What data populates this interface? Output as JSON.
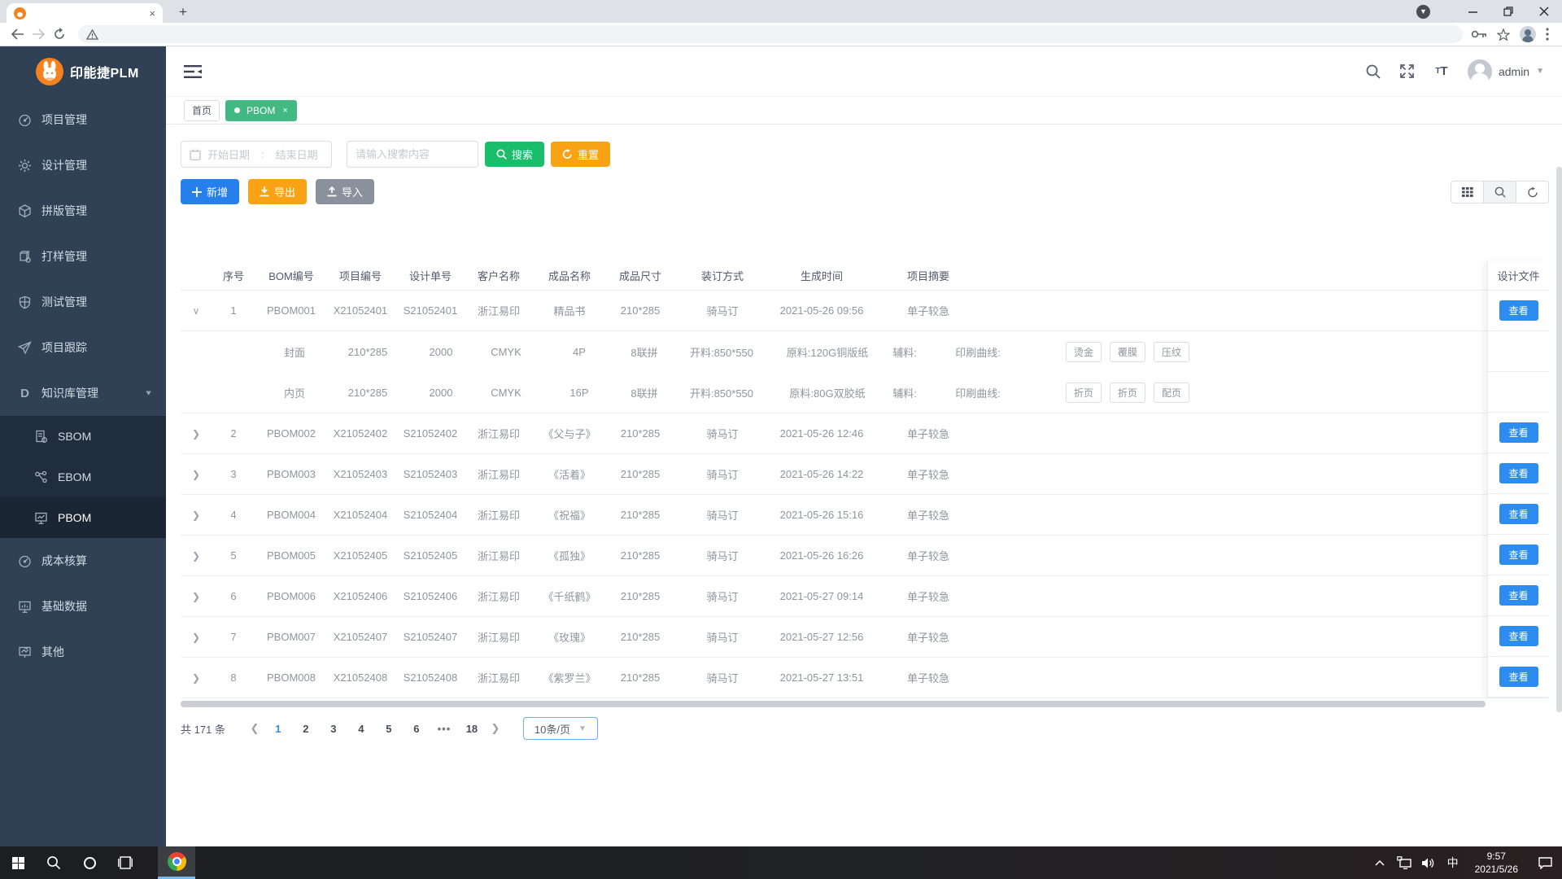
{
  "colors": {
    "primary": "#2d8cf0",
    "success": "#19be6b",
    "warning": "#f9a314",
    "tab_green": "#42b983",
    "sidebar_bg": "#304156",
    "submenu_bg": "#1f2d3d",
    "add_blue": "#2680eb",
    "import_gray": "#8a919c"
  },
  "browser": {
    "new_tab_label": "+",
    "tab_close": "×"
  },
  "header": {
    "logo_text": "印能捷PLM",
    "user_name": "admin"
  },
  "sidebar": {
    "items": [
      {
        "label": "项目管理",
        "icon": "dashboard-icon"
      },
      {
        "label": "设计管理",
        "icon": "gear-icon"
      },
      {
        "label": "拼版管理",
        "icon": "cube-icon"
      },
      {
        "label": "打样管理",
        "icon": "proof-icon"
      },
      {
        "label": "测试管理",
        "icon": "shield-icon"
      },
      {
        "label": "项目跟踪",
        "icon": "send-icon"
      },
      {
        "label": "知识库管理",
        "icon": "letter-d-icon",
        "expanded": true,
        "children": [
          {
            "label": "SBOM",
            "icon": "doc-icon"
          },
          {
            "label": "EBOM",
            "icon": "share-icon"
          },
          {
            "label": "PBOM",
            "icon": "monitor-icon",
            "active": true
          }
        ]
      },
      {
        "label": "成本核算",
        "icon": "dashboard-icon"
      },
      {
        "label": "基础数据",
        "icon": "data-icon"
      },
      {
        "label": "其他",
        "icon": "chart-icon"
      }
    ]
  },
  "page_tags": [
    {
      "label": "首页",
      "active": false,
      "closable": false
    },
    {
      "label": "PBOM",
      "active": true,
      "closable": true
    }
  ],
  "filters": {
    "date_start_placeholder": "开始日期",
    "date_separator": ":",
    "date_end_placeholder": "结束日期",
    "search_placeholder": "请输入搜索内容",
    "search_label": "搜索",
    "reset_label": "重置"
  },
  "actions": {
    "add_label": "新增",
    "export_label": "导出",
    "import_label": "导入"
  },
  "table": {
    "headers": [
      "序号",
      "BOM编号",
      "项目编号",
      "设计单号",
      "客户名称",
      "成品名称",
      "成品尺寸",
      "装订方式",
      "生成时间",
      "项目摘要"
    ],
    "fixed_header": "设计文件",
    "view_label": "查看",
    "rows": [
      {
        "no": "1",
        "bom": "PBOM001",
        "project": "X21052401",
        "design": "S21052401",
        "customer": "浙江易印",
        "product": "精品书",
        "size": "210*285",
        "binding": "骑马订",
        "time": "2021-05-26 09:56",
        "summary": "单子较急",
        "expanded": true
      },
      {
        "no": "2",
        "bom": "PBOM002",
        "project": "X21052402",
        "design": "S21052402",
        "customer": "浙江易印",
        "product": "《父与子》",
        "size": "210*285",
        "binding": "骑马订",
        "time": "2021-05-26 12:46",
        "summary": "单子较急",
        "expanded": false
      },
      {
        "no": "3",
        "bom": "PBOM003",
        "project": "X21052403",
        "design": "S21052403",
        "customer": "浙江易印",
        "product": "《活着》",
        "size": "210*285",
        "binding": "骑马订",
        "time": "2021-05-26 14:22",
        "summary": "单子较急",
        "expanded": false
      },
      {
        "no": "4",
        "bom": "PBOM004",
        "project": "X21052404",
        "design": "S21052404",
        "customer": "浙江易印",
        "product": "《祝福》",
        "size": "210*285",
        "binding": "骑马订",
        "time": "2021-05-26 15:16",
        "summary": "单子较急",
        "expanded": false
      },
      {
        "no": "5",
        "bom": "PBOM005",
        "project": "X21052405",
        "design": "S21052405",
        "customer": "浙江易印",
        "product": "《孤独》",
        "size": "210*285",
        "binding": "骑马订",
        "time": "2021-05-26 16:26",
        "summary": "单子较急",
        "expanded": false
      },
      {
        "no": "6",
        "bom": "PBOM006",
        "project": "X21052406",
        "design": "S21052406",
        "customer": "浙江易印",
        "product": "《千纸鹤》",
        "size": "210*285",
        "binding": "骑马订",
        "time": "2021-05-27 09:14",
        "summary": "单子较急",
        "expanded": false
      },
      {
        "no": "7",
        "bom": "PBOM007",
        "project": "X21052407",
        "design": "S21052407",
        "customer": "浙江易印",
        "product": "《玫瑰》",
        "size": "210*285",
        "binding": "骑马订",
        "time": "2021-05-27 12:56",
        "summary": "单子较急",
        "expanded": false
      },
      {
        "no": "8",
        "bom": "PBOM008",
        "project": "X21052408",
        "design": "S21052408",
        "customer": "浙江易印",
        "product": "《紫罗兰》",
        "size": "210*285",
        "binding": "骑马订",
        "time": "2021-05-27 13:51",
        "summary": "单子较急",
        "expanded": false
      }
    ],
    "subrows": [
      {
        "part": "封面",
        "size": "210*285",
        "qty": "2000",
        "color": "CMYK",
        "pages": "4P",
        "imposition": "8联拼",
        "cut": "开料:850*550",
        "material": "原料:120G铜版纸",
        "aux_label": "辅料:",
        "curve_label": "印刷曲线:",
        "tags": [
          "烫金",
          "覆膜",
          "压纹"
        ]
      },
      {
        "part": "内页",
        "size": "210*285",
        "qty": "2000",
        "color": "CMYK",
        "pages": "16P",
        "imposition": "8联拼",
        "cut": "开料:850*550",
        "material": "原料:80G双胶纸",
        "aux_label": "辅料:",
        "curve_label": "印刷曲线:",
        "tags": [
          "折页",
          "折页",
          "配页"
        ]
      }
    ]
  },
  "pagination": {
    "total_label": "共 171 条",
    "pages": [
      "1",
      "2",
      "3",
      "4",
      "5",
      "6",
      "•••",
      "18"
    ],
    "active_page": "1",
    "page_size": "10条/页"
  },
  "taskbar": {
    "ime": "中",
    "time": "9:57",
    "date": "2021/5/26"
  }
}
